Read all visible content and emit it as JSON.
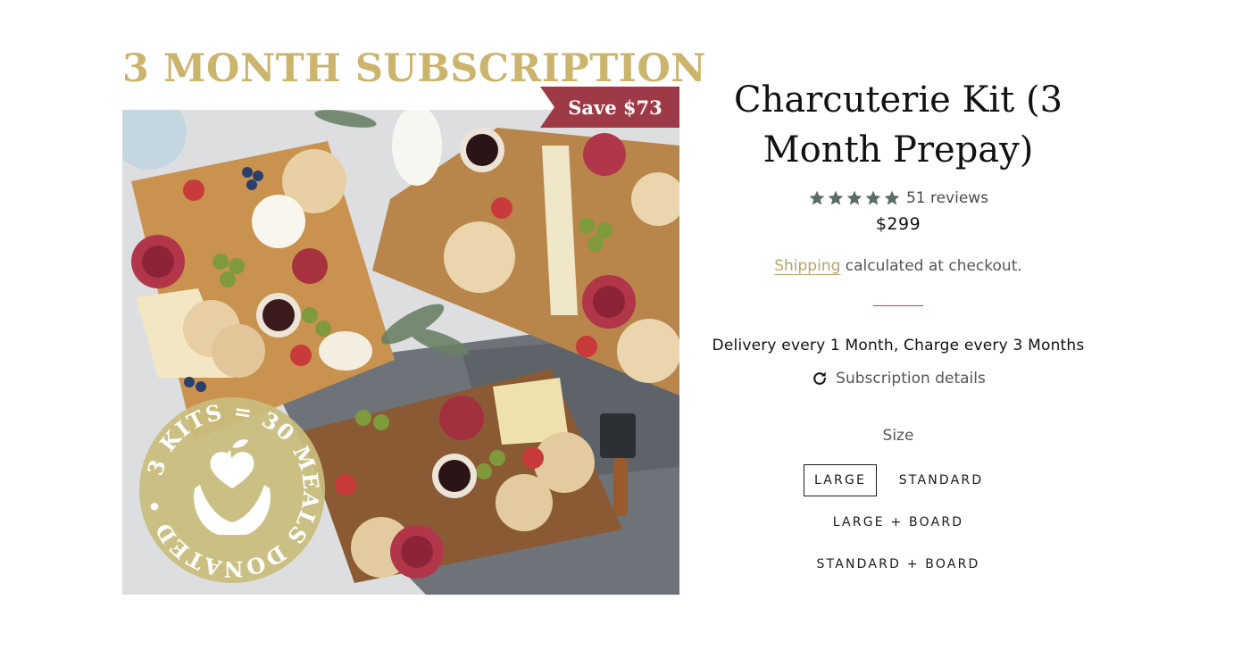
{
  "promo": {
    "heading": "3 MONTH SUBSCRIPTION",
    "ribbon": "Save $73",
    "badge_text": "3 KITS = 30 MEALS DONATED",
    "badge_separator": "•"
  },
  "product": {
    "title": "Charcuterie Kit (3 Month Prepay)",
    "rating": 5,
    "reviews": "51 reviews",
    "price": "$299",
    "shipping_link": "Shipping",
    "shipping_rest": " calculated at checkout.",
    "delivery": "Delivery every 1 Month, Charge every 3 Months",
    "subscription_details": "Subscription details"
  },
  "size": {
    "label": "Size",
    "options": [
      "LARGE",
      "STANDARD",
      "LARGE + BOARD",
      "STANDARD + BOARD"
    ],
    "selected": "LARGE"
  },
  "colors": {
    "gold": "#cbb46c",
    "ribbon": "#9e3a47",
    "star": "#5a6b68",
    "divider": "#b0455a"
  },
  "icons": [
    "star-icon",
    "refresh-icon",
    "heart-hands-icon"
  ]
}
